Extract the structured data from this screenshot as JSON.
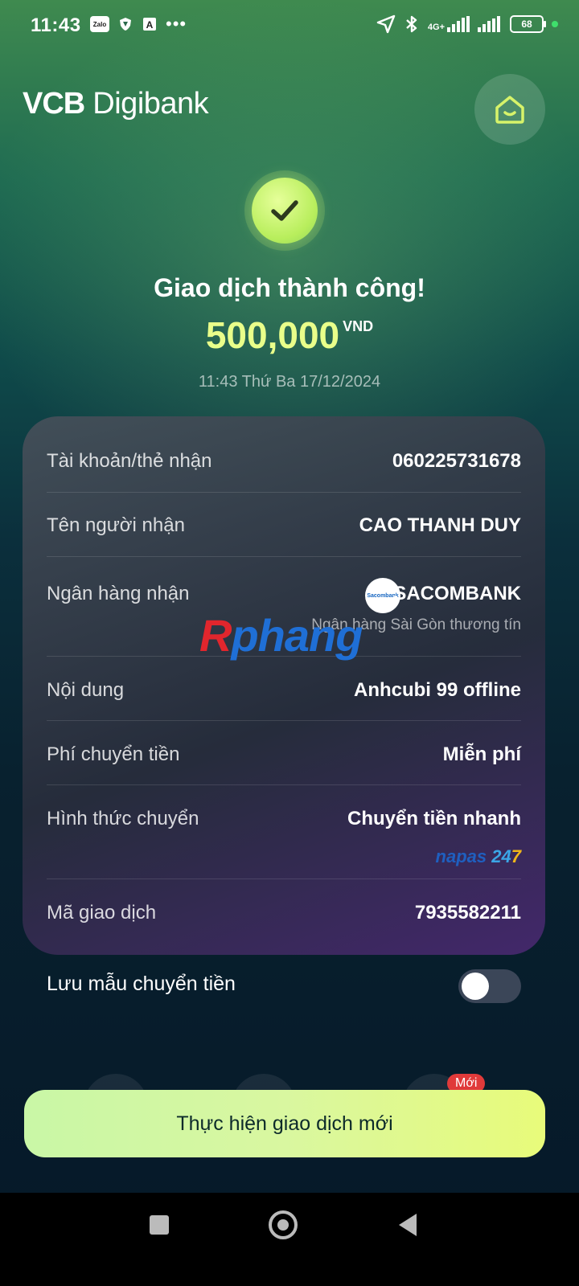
{
  "status_bar": {
    "time": "11:43",
    "zalo_label": "Zalo",
    "net_label": "4G+",
    "battery": "68"
  },
  "header": {
    "brand_vcb": "VCB",
    "brand_digibank": "Digibank"
  },
  "result": {
    "title": "Giao dịch thành công!",
    "amount": "500,000",
    "currency": "VND",
    "datetime": "11:43 Thứ Ba 17/12/2024"
  },
  "details": {
    "account_label": "Tài khoản/thẻ nhận",
    "account_value": "060225731678",
    "recipient_label": "Tên người nhận",
    "recipient_value": "CAO THANH DUY",
    "bank_label": "Ngân hàng nhận",
    "bank_logo_text": "Sacombank",
    "bank_value": "SACOMBANK",
    "bank_fullname": "Ngân hàng Sài Gòn thương tín",
    "content_label": "Nội dung",
    "content_value": "Anhcubi 99 offline",
    "fee_label": "Phí chuyển tiền",
    "fee_value": "Miễn phí",
    "method_label": "Hình thức chuyển",
    "method_value": "Chuyển tiền nhanh",
    "napas_text": "napas",
    "napas_num": "24",
    "napas_num2": "7",
    "txn_label": "Mã giao dịch",
    "txn_value": "7935582211"
  },
  "watermark": {
    "first": "R",
    "rest": "phang"
  },
  "save_template": {
    "label": "Lưu mẫu chuyển tiền",
    "enabled": false
  },
  "new_badge": "Mới",
  "primary_button": "Thực hiện giao dịch mới"
}
